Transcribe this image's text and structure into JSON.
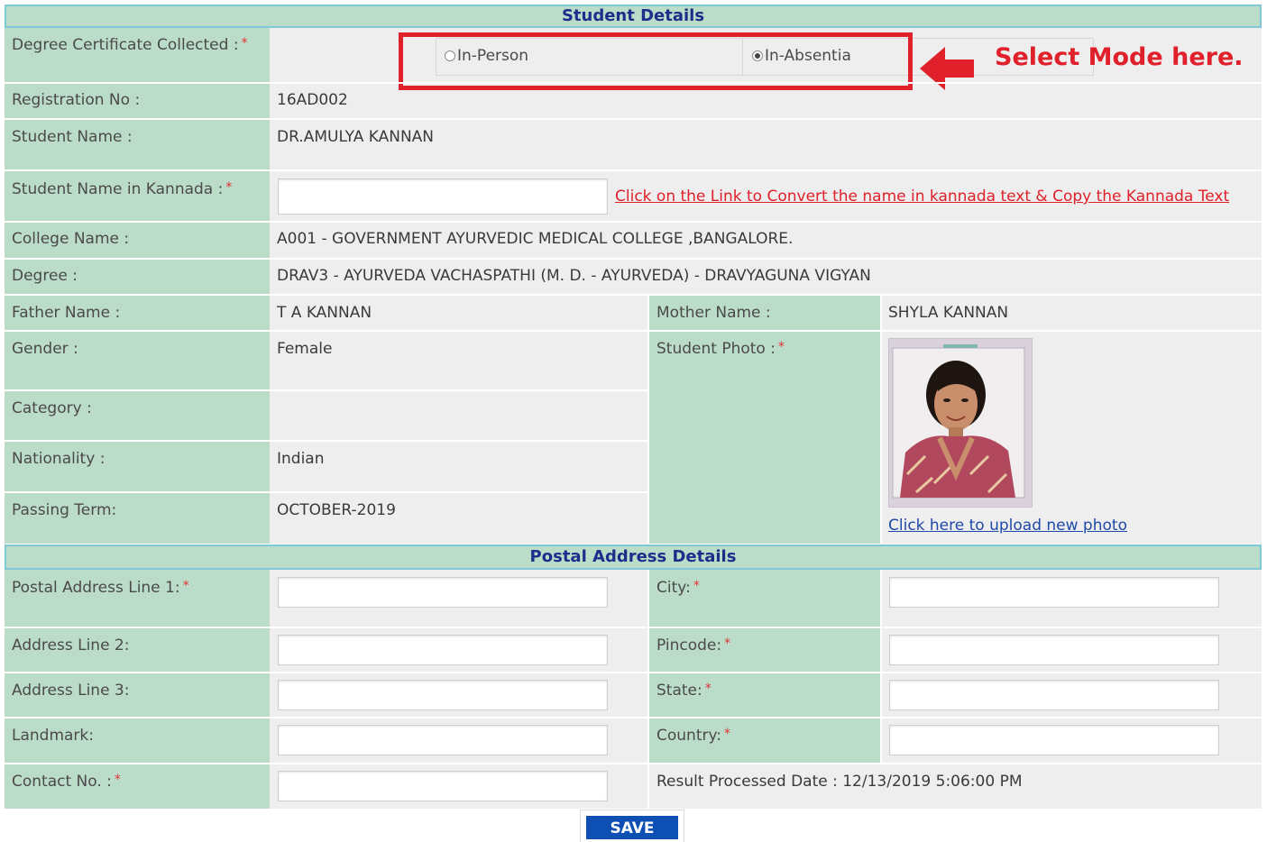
{
  "student_details": {
    "header": "Student Details",
    "degree_cert": {
      "label": "Degree Certificate Collected :",
      "required": "*",
      "options": [
        "In-Person",
        "In-Absentia"
      ],
      "selected": "In-Absentia"
    },
    "annotation": "Select Mode here.",
    "registration_no": {
      "label": "Registration No :",
      "value": "16AD002"
    },
    "student_name": {
      "label": "Student Name :",
      "value": "DR.AMULYA KANNAN"
    },
    "student_name_kannada": {
      "label": "Student Name in Kannada :",
      "required": "*",
      "value": "",
      "link": "Click on the Link to Convert the name in kannada text & Copy the Kannada Text"
    },
    "college_name": {
      "label": "College Name :",
      "value": "A001 - GOVERNMENT AYURVEDIC MEDICAL COLLEGE ,BANGALORE."
    },
    "degree": {
      "label": "Degree :",
      "value": "DRAV3 - AYURVEDA VACHASPATHI (M. D. - AYURVEDA) - DRAVYAGUNA VIGYAN"
    },
    "father_name": {
      "label": "Father Name :",
      "value": "T A KANNAN"
    },
    "mother_name": {
      "label": "Mother Name :",
      "value": "SHYLA KANNAN"
    },
    "gender": {
      "label": "Gender :",
      "value": "Female"
    },
    "student_photo": {
      "label": "Student Photo :",
      "required": "*",
      "upload_link": "Click here to upload new photo"
    },
    "category": {
      "label": "Category :",
      "value": ""
    },
    "nationality": {
      "label": "Nationality :",
      "value": "Indian"
    },
    "passing_term": {
      "label": "Passing Term:",
      "value": "OCTOBER-2019"
    }
  },
  "postal": {
    "header": "Postal Address Details",
    "address1": {
      "label": "Postal Address Line 1:",
      "required": "*",
      "value": ""
    },
    "address2": {
      "label": "Address Line 2:",
      "value": ""
    },
    "address3": {
      "label": "Address Line 3:",
      "value": ""
    },
    "landmark": {
      "label": "Landmark:",
      "value": ""
    },
    "contact": {
      "label": "Contact No. :",
      "required": "*",
      "value": ""
    },
    "city": {
      "label": "City:",
      "required": "*",
      "value": ""
    },
    "pincode": {
      "label": "Pincode:",
      "required": "*",
      "value": ""
    },
    "state": {
      "label": "State:",
      "required": "*",
      "value": ""
    },
    "country": {
      "label": "Country:",
      "required": "*",
      "value": ""
    },
    "result_processed": "Result Processed Date : 12/13/2019 5:06:00 PM"
  },
  "save_label": "SAVE",
  "colors": {
    "label_bg": "#bcdcca",
    "value_bg": "#eeeeee",
    "header_text": "#1a2f8a",
    "annotation_red": "#e0202a",
    "save_bg": "#0d4fb3"
  }
}
